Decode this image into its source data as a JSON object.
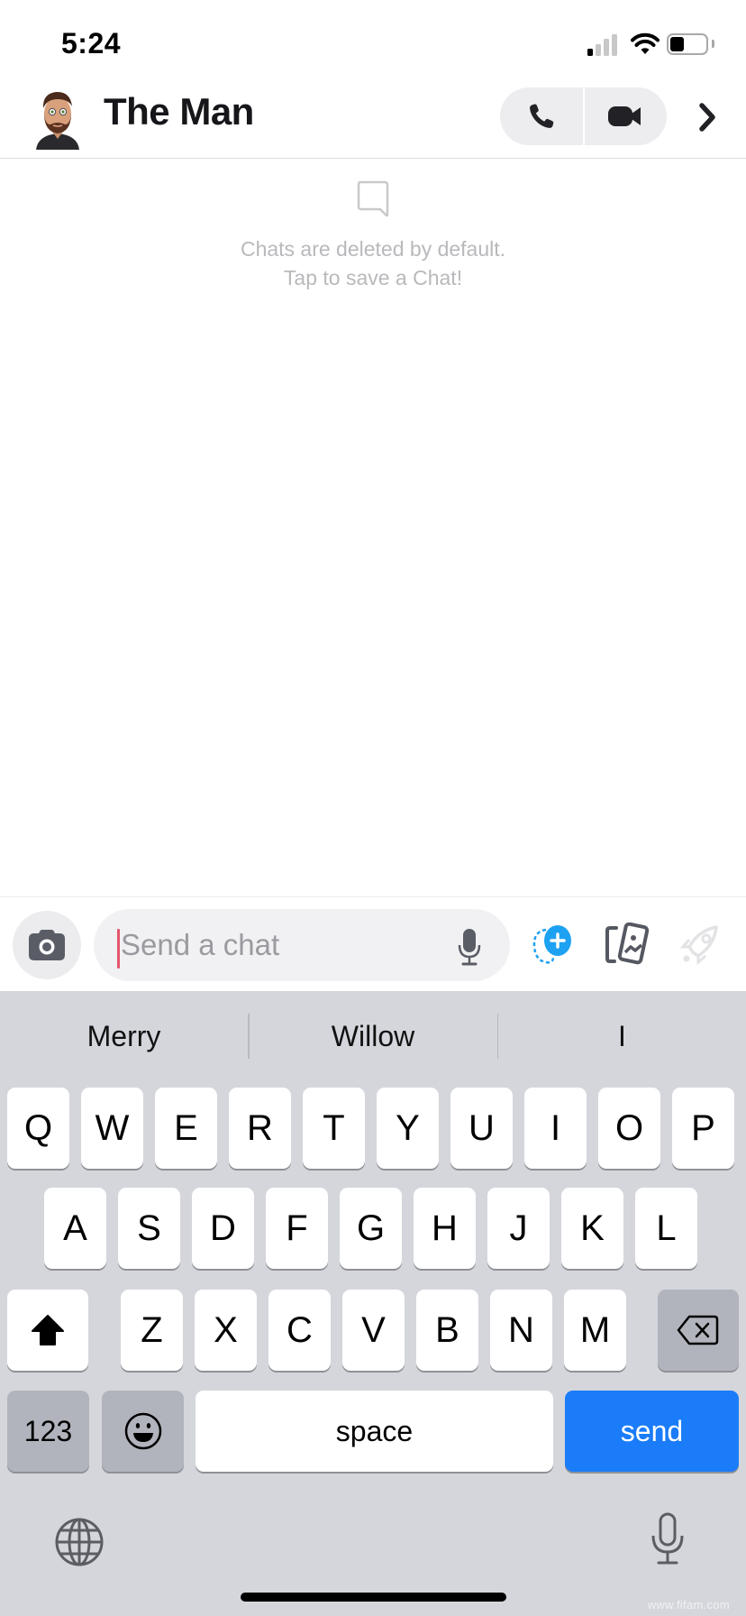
{
  "status_bar": {
    "time": "5:24",
    "signal_bars_active": 1,
    "signal_bars_total": 4,
    "wifi": "wifi-icon",
    "battery_level": 0.4
  },
  "header": {
    "avatar": "bitmoji-avatar",
    "title": "The Man",
    "voice_call_icon": "phone-icon",
    "video_call_icon": "video-camera-icon",
    "profile_chevron_icon": "chevron-right-icon"
  },
  "empty_state": {
    "icon": "chat-bubble-icon",
    "line1": "Chats are deleted by default.",
    "line2": "Tap to save a Chat!"
  },
  "input_bar": {
    "camera_icon": "camera-icon",
    "placeholder": "Send a chat",
    "value": "",
    "mic_icon": "microphone-icon",
    "bitmoji_icon": "bitmoji-add-icon",
    "memories_icon": "memories-cards-icon",
    "games_icon": "rocket-icon",
    "colors": {
      "caret": "#e3556b",
      "bitmoji_accent": "#1da1f2"
    }
  },
  "keyboard": {
    "suggestions": [
      "Merry",
      "Willow",
      "I"
    ],
    "rows": [
      [
        "Q",
        "W",
        "E",
        "R",
        "T",
        "Y",
        "U",
        "I",
        "O",
        "P"
      ],
      [
        "A",
        "S",
        "D",
        "F",
        "G",
        "H",
        "J",
        "K",
        "L"
      ],
      [
        "Z",
        "X",
        "C",
        "V",
        "B",
        "N",
        "M"
      ]
    ],
    "shift_icon": "shift-arrow-icon",
    "backspace_icon": "backspace-icon",
    "numbers_label": "123",
    "emoji_icon": "emoji-face-icon",
    "space_label": "space",
    "send_label": "send",
    "globe_icon": "globe-icon",
    "dictation_icon": "microphone-icon",
    "colors": {
      "send": "#1a7cf8",
      "background": "#d4d6dc"
    }
  },
  "watermark": "www.fifam.com"
}
